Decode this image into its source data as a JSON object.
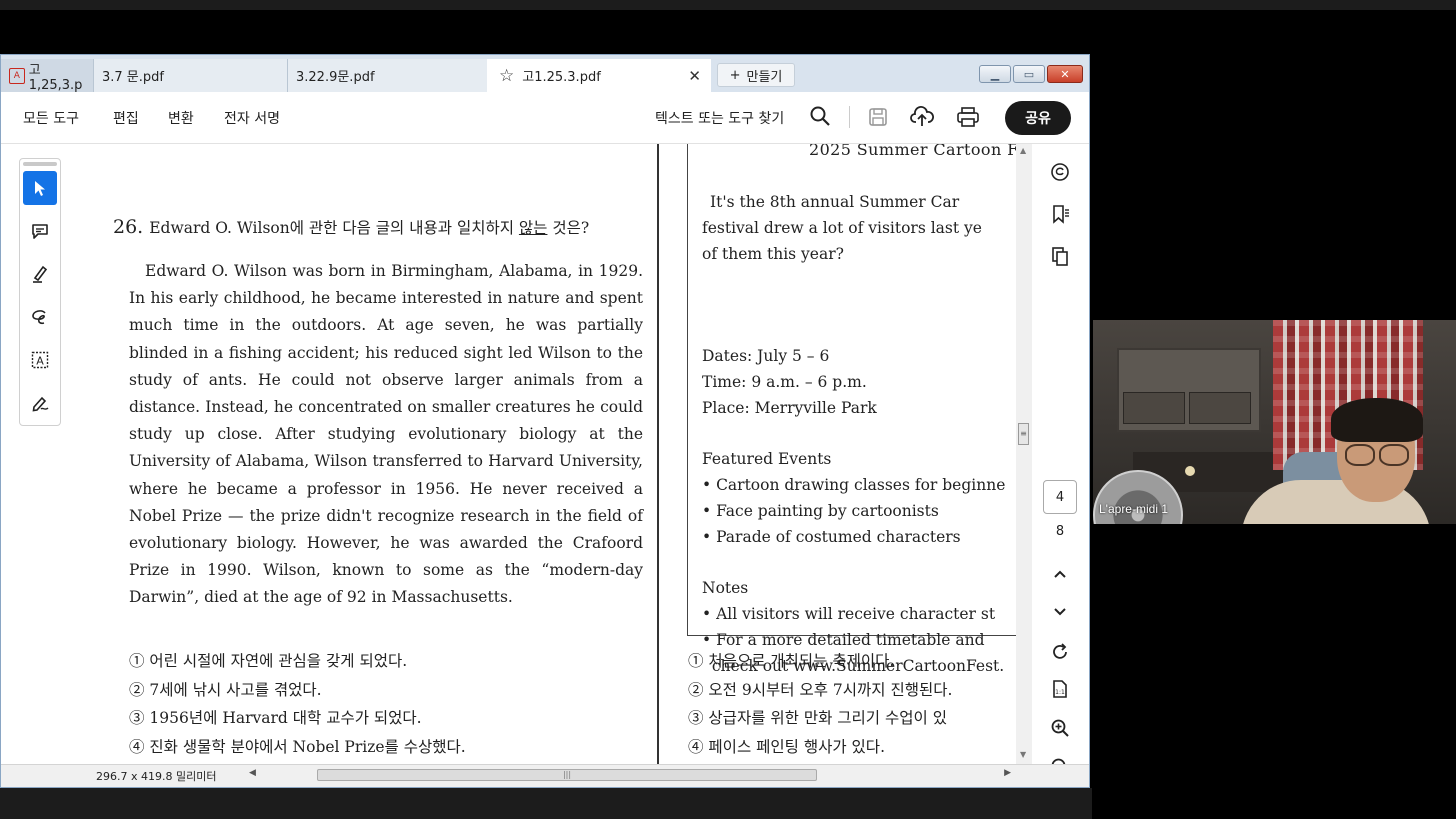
{
  "tabs": [
    {
      "label": "고1,25,3.p"
    },
    {
      "label": "3.7 문.pdf"
    },
    {
      "label": "3.22.9문.pdf"
    },
    {
      "label": "고1.25.3.pdf",
      "active": true
    }
  ],
  "new_tab_label": "만들기",
  "menu": {
    "items": [
      "모든 도구",
      "편집",
      "변환",
      "전자 서명"
    ],
    "find_tools": "텍스트 또는 도구 찾기",
    "share_label": "공유"
  },
  "question": {
    "number": "26.",
    "title_pre": "Edward O. Wilson에 관한 다음 글의 내용과 일치하지 ",
    "title_underlined": "않는",
    "title_post": " 것은?",
    "passage": "Edward O. Wilson was born in Birmingham, Alabama, in 1929. In his early childhood, he became interested in nature and spent much time in the outdoors. At age seven, he was partially blinded in a fishing accident; his reduced sight led Wilson to the study of ants. He could not observe larger animals from a distance. Instead, he concentrated on smaller creatures he could study up close. After studying evolutionary biology at the University of Alabama, Wilson transferred to Harvard University, where he became a professor in 1956. He never received a Nobel Prize — the prize didn't recognize research in the field of evolutionary biology. However, he was awarded the Crafoord Prize in 1990. Wilson, known to some as the “modern-day Darwin”, died at the age of 92 in Massachusetts.",
    "choices": [
      "① 어린 시절에 자연에 관심을 갖게 되었다.",
      "② 7세에 낚시 사고를 겪었다.",
      "③ 1956년에 Harvard 대학 교수가 되었다.",
      "④ 진화 생물학 분야에서 Nobel Prize를 수상했다."
    ]
  },
  "festival": {
    "title": "2025 Summer Cartoon F",
    "intro": [
      "It's the 8th annual Summer Car",
      "festival drew a lot of visitors last ye",
      "of them this year?"
    ],
    "details": [
      "Dates: July 5 – 6",
      "Time: 9 a.m. – 6 p.m.",
      "Place: Merryville Park"
    ],
    "featured_heading": "Featured Events",
    "featured": [
      "• Cartoon drawing classes for beginne",
      "• Face painting by cartoonists",
      "• Parade of costumed characters"
    ],
    "notes_heading": "Notes",
    "notes": [
      "• All visitors will receive character st",
      "• For a more detailed timetable and",
      "  check out www.SummerCartoonFest."
    ],
    "choices": [
      "① 처음으로 개최되는 축제이다.",
      "② 오전 9시부터 오후 7시까지 진행된다.",
      "③ 상급자를 위한 만화 그리기 수업이 있",
      "④ 페이스 페인팅 행사가 있다."
    ]
  },
  "page_nav": {
    "current": "4",
    "total": "8"
  },
  "status": {
    "dimensions": "296.7 x 419.8 밀리미터"
  },
  "webcam": {
    "participant_name": "L'apre-midi 1"
  },
  "colors": {
    "accent": "#1473e6",
    "share_bg": "#1a1a1a",
    "tabbar_bg": "#d9e3ee"
  },
  "icons": {
    "left_tools": [
      "select-arrow-icon",
      "add-comment-icon",
      "highlight-pen-icon",
      "draw-loop-icon",
      "text-select-icon",
      "sign-pen-icon"
    ],
    "right_tools": [
      "comment-icon",
      "bookmark-icon",
      "copy-pages-icon",
      "rotate-icon",
      "page-properties-icon",
      "zoom-in-icon",
      "zoom-out-icon"
    ]
  }
}
